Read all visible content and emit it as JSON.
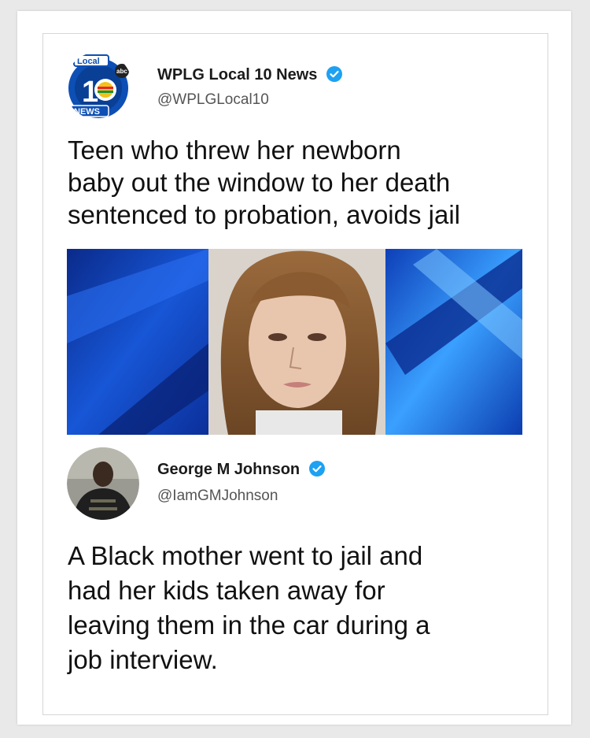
{
  "tweet1": {
    "display_name": "WPLG Local 10 News",
    "handle": "@WPLGLocal10",
    "text": "Teen who threw her newborn\nbaby out the window to her death\nsentenced to probation, avoids jail",
    "avatar": {
      "icon": "local10-news-logo",
      "logo_top": "Local",
      "logo_number": "10",
      "logo_bottom": "NEWS",
      "logo_badge": "abc"
    },
    "media": {
      "description_icon": "mugshot-photo"
    }
  },
  "tweet2": {
    "display_name": "George M Johnson",
    "handle": "@IamGMJohnson",
    "text": "A Black mother went to jail and\nhad her kids taken away for\nleaving them in the car during a\njob interview."
  },
  "colors": {
    "verified": "#1da1f2",
    "brand_blue": "#0d55c4",
    "text": "#111111"
  }
}
